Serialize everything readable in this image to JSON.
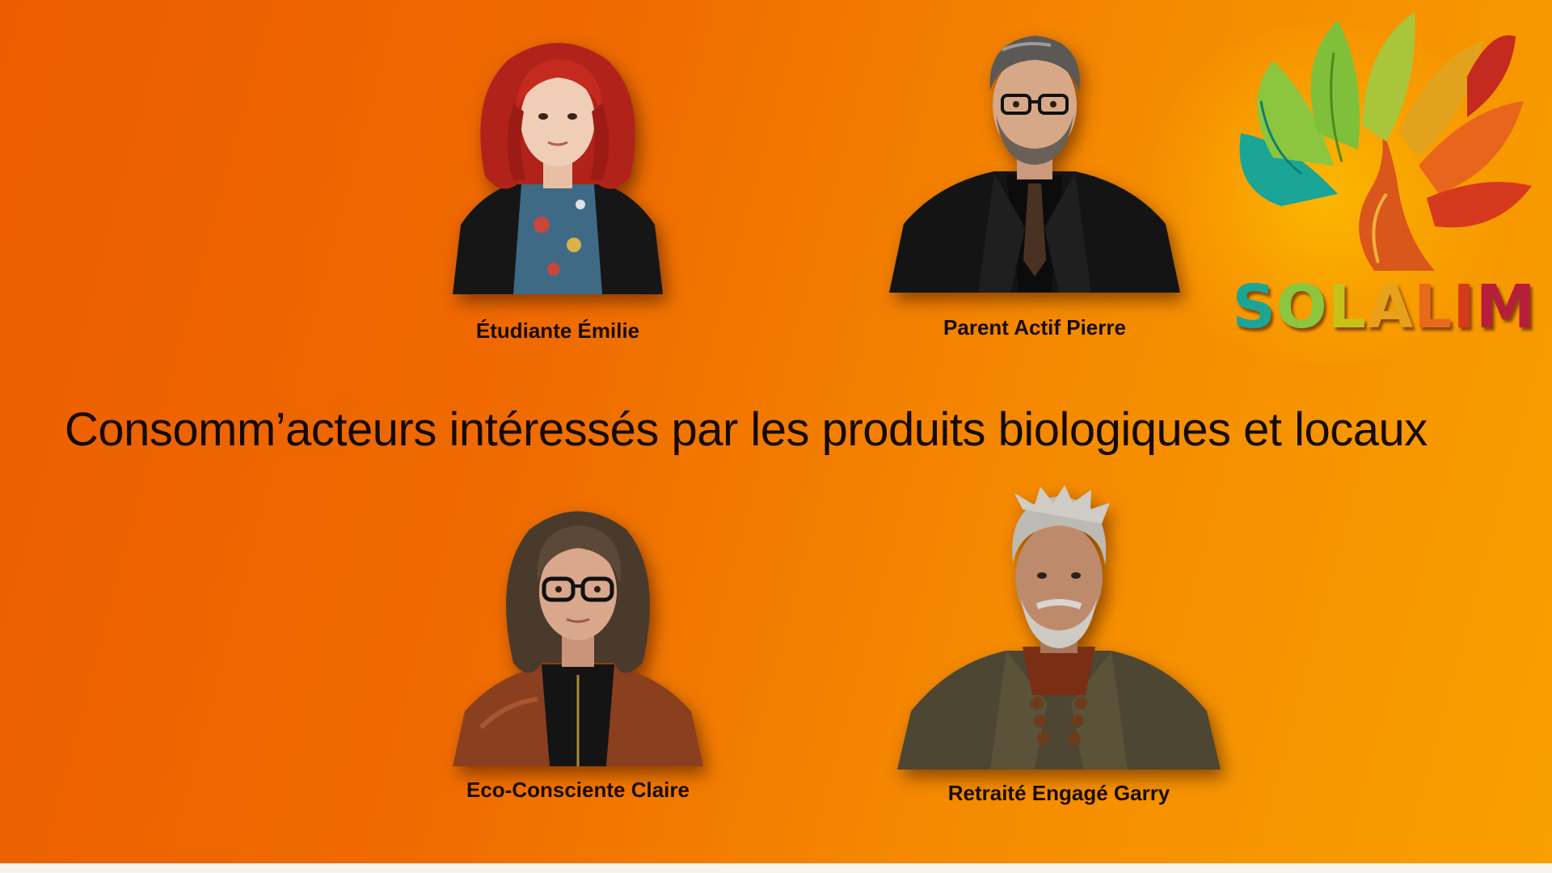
{
  "headline": "Consomm’acteurs intéressés par les produits biologiques et locaux",
  "personas": [
    {
      "name": "Étudiante Émilie",
      "icon": "student-portrait-icon"
    },
    {
      "name": "Parent Actif Pierre",
      "icon": "parent-portrait-icon"
    },
    {
      "name": "Eco-Consciente Claire",
      "icon": "eco-portrait-icon"
    },
    {
      "name": "Retraité Engagé Garry",
      "icon": "retiree-portrait-icon"
    }
  ],
  "logo": {
    "wordmark": "SOLALIM",
    "icon": "leaf-tree-logo-icon",
    "letter_colors": [
      "#1aa596",
      "#8cc63e",
      "#c7c21a",
      "#e8a21a",
      "#e86a1c",
      "#d63a1e",
      "#b51f3a"
    ]
  }
}
